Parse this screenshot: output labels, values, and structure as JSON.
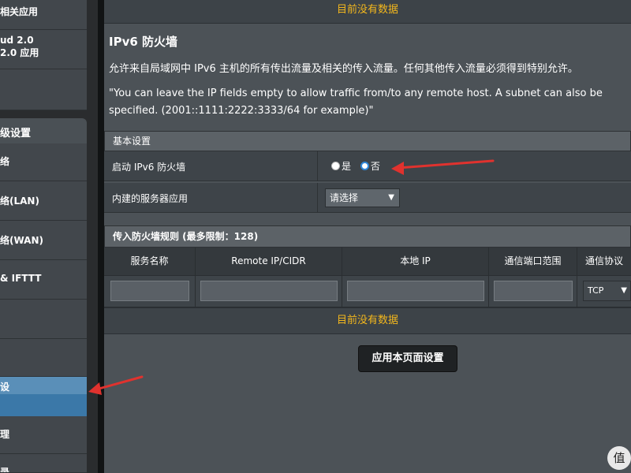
{
  "sidebar": {
    "items": [
      {
        "label": "相关应用"
      },
      {
        "label": "ud 2.0",
        "label2": "2.0 应用"
      },
      {
        "label": ""
      }
    ],
    "header": "级设置",
    "sub_items": [
      {
        "label": "络"
      },
      {
        "label": "络(LAN)"
      },
      {
        "label": "络(WAN)"
      },
      {
        "label": "& IFTTT"
      },
      {
        "label": ""
      },
      {
        "label": ""
      },
      {
        "label": "设"
      },
      {
        "label": "理"
      },
      {
        "label": "录"
      }
    ]
  },
  "main": {
    "top_notice": "目前没有数据",
    "title": "IPv6 防火墙",
    "description": "允许来自局域网中 IPv6 主机的所有传出流量及相关的传入流量。任何其他传入流量必须得到特别允许。",
    "note": "\"You can leave the IP fields empty to allow traffic from/to any remote host. A subnet can also be specified. (2001::1111:2222:3333/64 for example)\"",
    "basic": {
      "header": "基本设置",
      "enable_label": "启动 IPv6 防火墙",
      "radio_yes": "是",
      "radio_no": "否",
      "selected": "否",
      "server_label": "内建的服务器应用",
      "server_select": "请选择"
    },
    "rules": {
      "header": "传入防火墙规则 (最多限制：128)",
      "columns": [
        "服务名称",
        "Remote IP/CIDR",
        "本地 IP",
        "通信端口范围",
        "通信协议"
      ],
      "protocol_value": "TCP",
      "empty_notice": "目前没有数据"
    },
    "apply_button": "应用本页面设置"
  },
  "watermark": "值",
  "colors": {
    "notice": "#f3b71d",
    "active_sidebar": "#3b78a8",
    "arrow": "#e0322e",
    "radio_selected": "#2e86d8"
  }
}
